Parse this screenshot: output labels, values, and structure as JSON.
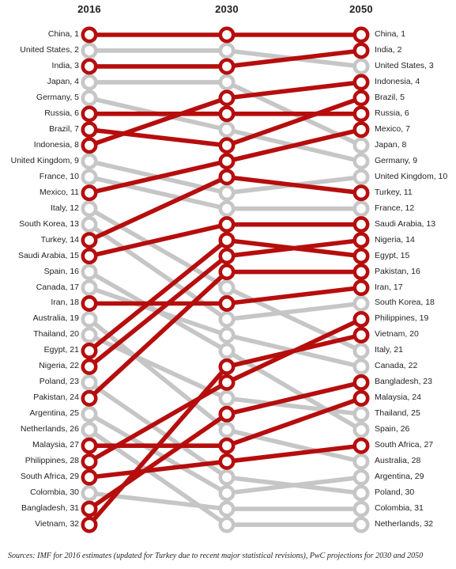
{
  "headers": {
    "col1": "2016",
    "col2": "2030",
    "col3": "2050"
  },
  "source_note": "Sources: IMF for 2016 estimates (updated for Turkey due to recent major statistical revisions), PwC projections for 2030 and 2050",
  "colors": {
    "highlight": "#B60D0D",
    "muted": "#C6C6C6",
    "text": "#231f20",
    "background": "#ffffff"
  },
  "chart_data": {
    "type": "line",
    "title": "",
    "subtitle": "",
    "xlabel": "",
    "ylabel": "",
    "chart_kind": "bump-chart-ranking-slopegraph",
    "x": [
      "2016",
      "2030",
      "2050"
    ],
    "axis_ranges": {
      "rank_min": 1,
      "rank_max": 32
    },
    "grid": false,
    "legend_position": "none",
    "columns": [
      {
        "year": "2016",
        "labels": [
          "China,  1",
          "United States,  2",
          "India,  3",
          "Japan,  4",
          "Germany,  5",
          "Russia,  6",
          "Brazil,  7",
          "Indonesia,  8",
          "United Kingdom,  9",
          "France,  10",
          "Mexico,  11",
          "Italy,  12",
          "South Korea,  13",
          "Turkey,  14",
          "Saudi Arabia,  15",
          "Spain,  16",
          "Canada,  17",
          "Iran,  18",
          "Australia,  19",
          "Thailand,  20",
          "Egypt,  21",
          "Nigeria,  22",
          "Poland,  23",
          "Pakistan,  24",
          "Argentina,  25",
          "Netherlands,  26",
          "Malaysia,  27",
          "Philippines,  28",
          "South Africa,  29",
          "Colombia,  30",
          "Bangladesh,  31",
          "Vietnam,  32"
        ]
      },
      {
        "year": "2030",
        "labels": [
          "China,  1",
          "United States,  2",
          "India,  3",
          "Japan,  4",
          "Indonesia,  5",
          "Russia,  6",
          "Germany,  7",
          "Brazil,  8",
          "Mexico,  9",
          "Turkey,  10",
          "United Kingdom,  11",
          "France,  12",
          "Saudi Arabia,  13",
          "Egypt,  14",
          "Nigeria,  15",
          "Pakistan,  16",
          "Italy,  17",
          "Iran,  18",
          "South Korea,  19",
          "Canada,  20",
          "Spain,  21",
          "Vietnam,  22",
          "Philippines,  23",
          "Thailand,  24",
          "Bangladesh,  25",
          "Australia,  26",
          "Malaysia,  27",
          "South Africa,  28",
          "Poland,  29",
          "Argentina,  30",
          "Colombia,  31",
          "Netherlands,  32"
        ]
      },
      {
        "year": "2050",
        "labels": [
          "China,  1",
          "India,  2",
          "United States,  3",
          "Indonesia,  4",
          "Brazil,  5",
          "Russia,  6",
          "Mexico,  7",
          "Japan,  8",
          "Germany,  9",
          "United Kingdom,  10",
          "Turkey,  11",
          "France,  12",
          "Saudi Arabia,  13",
          "Nigeria,  14",
          "Egypt,  15",
          "Pakistan,  16",
          "Iran,  17",
          "South Korea,  18",
          "Philippines,  19",
          "Vietnam,  20",
          "Italy,  21",
          "Canada,  22",
          "Bangladesh,  23",
          "Malaysia,  24",
          "Thailand,  25",
          "Spain,  26",
          "South Africa,  27",
          "Australia,  28",
          "Argentina,  29",
          "Poland,  30",
          "Colombia,  31",
          "Netherlands,  32"
        ]
      }
    ],
    "series": [
      {
        "name": "China",
        "values": [
          1,
          1,
          1
        ],
        "highlight": true
      },
      {
        "name": "United States",
        "values": [
          2,
          2,
          3
        ],
        "highlight": false
      },
      {
        "name": "India",
        "values": [
          3,
          3,
          2
        ],
        "highlight": true
      },
      {
        "name": "Japan",
        "values": [
          4,
          4,
          8
        ],
        "highlight": false
      },
      {
        "name": "Germany",
        "values": [
          5,
          7,
          9
        ],
        "highlight": false
      },
      {
        "name": "Russia",
        "values": [
          6,
          6,
          6
        ],
        "highlight": true
      },
      {
        "name": "Brazil",
        "values": [
          7,
          8,
          5
        ],
        "highlight": true
      },
      {
        "name": "Indonesia",
        "values": [
          8,
          5,
          4
        ],
        "highlight": true
      },
      {
        "name": "United Kingdom",
        "values": [
          9,
          11,
          10
        ],
        "highlight": false
      },
      {
        "name": "France",
        "values": [
          10,
          12,
          12
        ],
        "highlight": false
      },
      {
        "name": "Mexico",
        "values": [
          11,
          9,
          7
        ],
        "highlight": true
      },
      {
        "name": "Italy",
        "values": [
          12,
          17,
          21
        ],
        "highlight": false
      },
      {
        "name": "South Korea",
        "values": [
          13,
          19,
          18
        ],
        "highlight": false
      },
      {
        "name": "Turkey",
        "values": [
          14,
          10,
          11
        ],
        "highlight": true
      },
      {
        "name": "Saudi Arabia",
        "values": [
          15,
          13,
          13
        ],
        "highlight": true
      },
      {
        "name": "Spain",
        "values": [
          16,
          21,
          26
        ],
        "highlight": false
      },
      {
        "name": "Canada",
        "values": [
          17,
          20,
          22
        ],
        "highlight": false
      },
      {
        "name": "Iran",
        "values": [
          18,
          18,
          17
        ],
        "highlight": true
      },
      {
        "name": "Australia",
        "values": [
          19,
          26,
          28
        ],
        "highlight": false
      },
      {
        "name": "Thailand",
        "values": [
          20,
          24,
          25
        ],
        "highlight": false
      },
      {
        "name": "Egypt",
        "values": [
          21,
          14,
          15
        ],
        "highlight": true
      },
      {
        "name": "Nigeria",
        "values": [
          22,
          15,
          14
        ],
        "highlight": true
      },
      {
        "name": "Poland",
        "values": [
          23,
          29,
          30
        ],
        "highlight": false
      },
      {
        "name": "Pakistan",
        "values": [
          24,
          16,
          16
        ],
        "highlight": true
      },
      {
        "name": "Argentina",
        "values": [
          25,
          30,
          29
        ],
        "highlight": false
      },
      {
        "name": "Netherlands",
        "values": [
          26,
          32,
          32
        ],
        "highlight": false
      },
      {
        "name": "Malaysia",
        "values": [
          27,
          27,
          24
        ],
        "highlight": true
      },
      {
        "name": "Philippines",
        "values": [
          28,
          23,
          19
        ],
        "highlight": true
      },
      {
        "name": "South Africa",
        "values": [
          29,
          28,
          27
        ],
        "highlight": true
      },
      {
        "name": "Colombia",
        "values": [
          30,
          31,
          31
        ],
        "highlight": false
      },
      {
        "name": "Bangladesh",
        "values": [
          31,
          25,
          23
        ],
        "highlight": true
      },
      {
        "name": "Vietnam",
        "values": [
          32,
          22,
          20
        ],
        "highlight": true
      }
    ]
  },
  "geometry": {
    "col_x": [
      113,
      287,
      457
    ],
    "row_top": 44,
    "row_step": 19.97,
    "node_radius": 8.2,
    "node_stroke": 4.6,
    "link_width": 5.6
  }
}
